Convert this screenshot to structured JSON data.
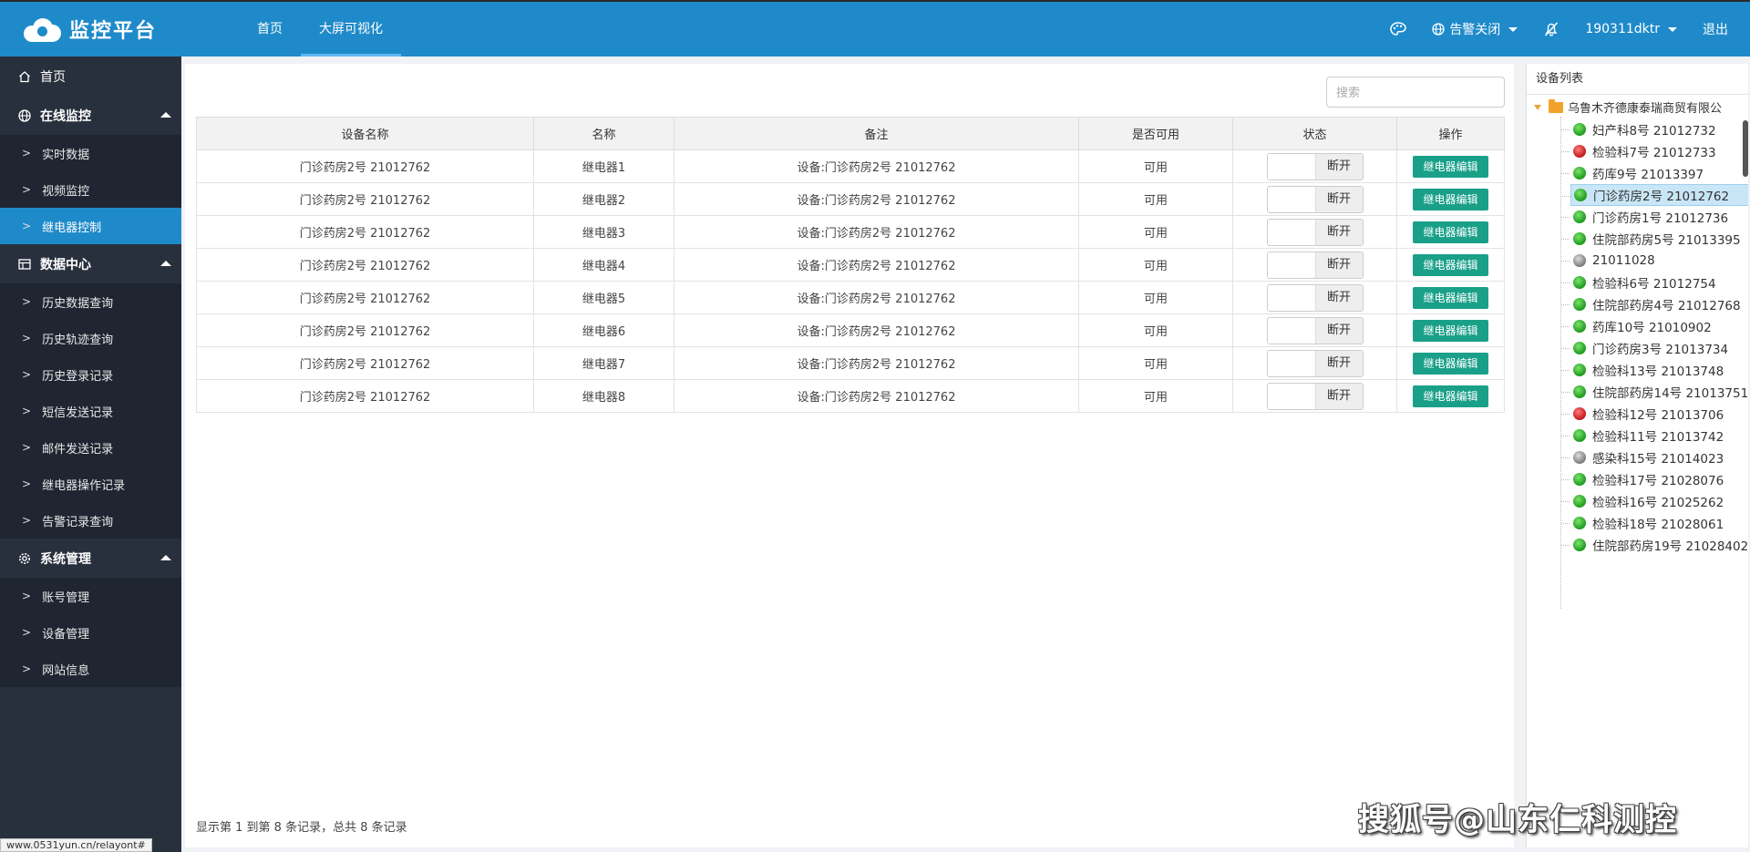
{
  "header": {
    "logo_text": "监控平台",
    "nav": [
      "首页",
      "大屏可视化"
    ],
    "alarm_label": "告警关闭",
    "user_label": "190311dktr",
    "logout_label": "退出"
  },
  "sidebar": {
    "home": "首页",
    "groups": [
      {
        "label": "在线监控",
        "items": [
          "实时数据",
          "视频监控",
          "继电器控制"
        ]
      },
      {
        "label": "数据中心",
        "items": [
          "历史数据查询",
          "历史轨迹查询",
          "历史登录记录",
          "短信发送记录",
          "邮件发送记录",
          "继电器操作记录",
          "告警记录查询"
        ]
      },
      {
        "label": "系统管理",
        "items": [
          "账号管理",
          "设备管理",
          "网站信息"
        ]
      }
    ],
    "active_item": "继电器控制"
  },
  "main": {
    "search_placeholder": "搜索",
    "columns": [
      "设备名称",
      "名称",
      "备注",
      "是否可用",
      "状态",
      "操作"
    ],
    "rows": [
      {
        "device": "门诊药房2号 21012762",
        "name": "继电器1",
        "remark": "设备:门诊药房2号 21012762",
        "available": "可用",
        "state": "断开",
        "action": "继电器编辑"
      },
      {
        "device": "门诊药房2号 21012762",
        "name": "继电器2",
        "remark": "设备:门诊药房2号 21012762",
        "available": "可用",
        "state": "断开",
        "action": "继电器编辑"
      },
      {
        "device": "门诊药房2号 21012762",
        "name": "继电器3",
        "remark": "设备:门诊药房2号 21012762",
        "available": "可用",
        "state": "断开",
        "action": "继电器编辑"
      },
      {
        "device": "门诊药房2号 21012762",
        "name": "继电器4",
        "remark": "设备:门诊药房2号 21012762",
        "available": "可用",
        "state": "断开",
        "action": "继电器编辑"
      },
      {
        "device": "门诊药房2号 21012762",
        "name": "继电器5",
        "remark": "设备:门诊药房2号 21012762",
        "available": "可用",
        "state": "断开",
        "action": "继电器编辑"
      },
      {
        "device": "门诊药房2号 21012762",
        "name": "继电器6",
        "remark": "设备:门诊药房2号 21012762",
        "available": "可用",
        "state": "断开",
        "action": "继电器编辑"
      },
      {
        "device": "门诊药房2号 21012762",
        "name": "继电器7",
        "remark": "设备:门诊药房2号 21012762",
        "available": "可用",
        "state": "断开",
        "action": "继电器编辑"
      },
      {
        "device": "门诊药房2号 21012762",
        "name": "继电器8",
        "remark": "设备:门诊药房2号 21012762",
        "available": "可用",
        "state": "断开",
        "action": "继电器编辑"
      }
    ],
    "pager_info": "显示第 1 到第 8 条记录，总共 8 条记录"
  },
  "device_panel": {
    "title": "设备列表",
    "root": "乌鲁木齐德康泰瑞商贸有限公",
    "devices": [
      {
        "label": "妇产科8号 21012732",
        "status": "green"
      },
      {
        "label": "检验科7号 21012733",
        "status": "red"
      },
      {
        "label": "药库9号 21013397",
        "status": "green"
      },
      {
        "label": "门诊药房2号 21012762",
        "status": "green",
        "selected": true
      },
      {
        "label": "门诊药房1号 21012736",
        "status": "green"
      },
      {
        "label": "住院部药房5号 21013395",
        "status": "green"
      },
      {
        "label": "21011028",
        "status": "grey"
      },
      {
        "label": "检验科6号 21012754",
        "status": "green"
      },
      {
        "label": "住院部药房4号 21012768",
        "status": "green"
      },
      {
        "label": "药库10号 21010902",
        "status": "green"
      },
      {
        "label": "门诊药房3号 21013734",
        "status": "green"
      },
      {
        "label": "检验科13号 21013748",
        "status": "green"
      },
      {
        "label": "住院部药房14号 21013751",
        "status": "green"
      },
      {
        "label": "检验科12号 21013706",
        "status": "red"
      },
      {
        "label": "检验科11号 21013742",
        "status": "green"
      },
      {
        "label": "感染科15号 21014023",
        "status": "grey"
      },
      {
        "label": "检验科17号 21028076",
        "status": "green"
      },
      {
        "label": "检验科16号 21025262",
        "status": "green"
      },
      {
        "label": "检验科18号 21028061",
        "status": "green"
      },
      {
        "label": "住院部药房19号 21028402",
        "status": "green"
      }
    ]
  },
  "watermark": "搜狐号@山东仁科测控",
  "status_url": "www.0531yun.cn/relayont#",
  "colors": {
    "header": "#1f8ac9",
    "sidebar": "#28303d",
    "accent_button": "#1aa089"
  }
}
